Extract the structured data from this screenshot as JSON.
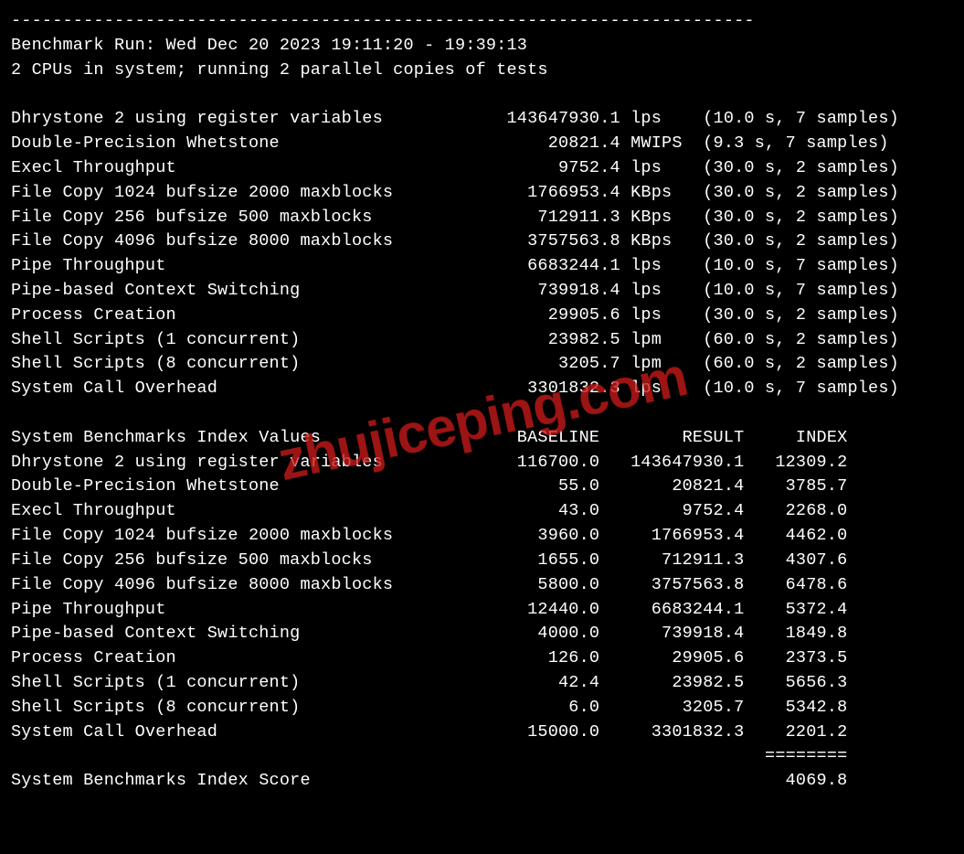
{
  "separator": "------------------------------------------------------------------------",
  "header": {
    "run_line": "Benchmark Run: Wed Dec 20 2023 19:11:20 - 19:39:13",
    "cpu_line": "2 CPUs in system; running 2 parallel copies of tests"
  },
  "results": [
    {
      "name": "Dhrystone 2 using register variables",
      "value": "143647930.1",
      "unit": "lps",
      "timing": "(10.0 s, 7 samples)"
    },
    {
      "name": "Double-Precision Whetstone",
      "value": "20821.4",
      "unit": "MWIPS",
      "timing": "(9.3 s, 7 samples)"
    },
    {
      "name": "Execl Throughput",
      "value": "9752.4",
      "unit": "lps",
      "timing": "(30.0 s, 2 samples)"
    },
    {
      "name": "File Copy 1024 bufsize 2000 maxblocks",
      "value": "1766953.4",
      "unit": "KBps",
      "timing": "(30.0 s, 2 samples)"
    },
    {
      "name": "File Copy 256 bufsize 500 maxblocks",
      "value": "712911.3",
      "unit": "KBps",
      "timing": "(30.0 s, 2 samples)"
    },
    {
      "name": "File Copy 4096 bufsize 8000 maxblocks",
      "value": "3757563.8",
      "unit": "KBps",
      "timing": "(30.0 s, 2 samples)"
    },
    {
      "name": "Pipe Throughput",
      "value": "6683244.1",
      "unit": "lps",
      "timing": "(10.0 s, 7 samples)"
    },
    {
      "name": "Pipe-based Context Switching",
      "value": "739918.4",
      "unit": "lps",
      "timing": "(10.0 s, 7 samples)"
    },
    {
      "name": "Process Creation",
      "value": "29905.6",
      "unit": "lps",
      "timing": "(30.0 s, 2 samples)"
    },
    {
      "name": "Shell Scripts (1 concurrent)",
      "value": "23982.5",
      "unit": "lpm",
      "timing": "(60.0 s, 2 samples)"
    },
    {
      "name": "Shell Scripts (8 concurrent)",
      "value": "3205.7",
      "unit": "lpm",
      "timing": "(60.0 s, 2 samples)"
    },
    {
      "name": "System Call Overhead",
      "value": "3301832.3",
      "unit": "lps",
      "timing": "(10.0 s, 7 samples)"
    }
  ],
  "index_header": {
    "label": "System Benchmarks Index Values",
    "baseline": "BASELINE",
    "result": "RESULT",
    "index": "INDEX"
  },
  "index_rows": [
    {
      "name": "Dhrystone 2 using register variables",
      "baseline": "116700.0",
      "result": "143647930.1",
      "index": "12309.2"
    },
    {
      "name": "Double-Precision Whetstone",
      "baseline": "55.0",
      "result": "20821.4",
      "index": "3785.7"
    },
    {
      "name": "Execl Throughput",
      "baseline": "43.0",
      "result": "9752.4",
      "index": "2268.0"
    },
    {
      "name": "File Copy 1024 bufsize 2000 maxblocks",
      "baseline": "3960.0",
      "result": "1766953.4",
      "index": "4462.0"
    },
    {
      "name": "File Copy 256 bufsize 500 maxblocks",
      "baseline": "1655.0",
      "result": "712911.3",
      "index": "4307.6"
    },
    {
      "name": "File Copy 4096 bufsize 8000 maxblocks",
      "baseline": "5800.0",
      "result": "3757563.8",
      "index": "6478.6"
    },
    {
      "name": "Pipe Throughput",
      "baseline": "12440.0",
      "result": "6683244.1",
      "index": "5372.4"
    },
    {
      "name": "Pipe-based Context Switching",
      "baseline": "4000.0",
      "result": "739918.4",
      "index": "1849.8"
    },
    {
      "name": "Process Creation",
      "baseline": "126.0",
      "result": "29905.6",
      "index": "2373.5"
    },
    {
      "name": "Shell Scripts (1 concurrent)",
      "baseline": "42.4",
      "result": "23982.5",
      "index": "5656.3"
    },
    {
      "name": "Shell Scripts (8 concurrent)",
      "baseline": "6.0",
      "result": "3205.7",
      "index": "5342.8"
    },
    {
      "name": "System Call Overhead",
      "baseline": "15000.0",
      "result": "3301832.3",
      "index": "2201.2"
    }
  ],
  "score_separator": "========",
  "score_label": "System Benchmarks Index Score",
  "score_value": "4069.8",
  "watermark": "zhujiceping.com"
}
